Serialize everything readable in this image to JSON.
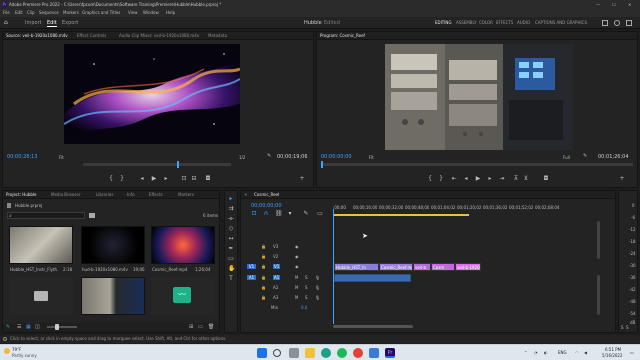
{
  "window": {
    "title": "Adobe Premiere Pro 2022 - C:\\Users\\fpcom\\Documents\\Software Training\\Premiere\\Hubble\\Hubble.prproj *",
    "controls": [
      "—",
      "☐",
      "✕"
    ]
  },
  "menu": [
    "File",
    "Edit",
    "Clip",
    "Sequence",
    "Markers",
    "Graphics and Titles",
    "View",
    "Window",
    "Help"
  ],
  "header": {
    "nav": [
      "Import",
      "Edit",
      "Export"
    ],
    "active_nav": "Edit",
    "project": "Hubble",
    "status": "Edited",
    "workspaces": [
      "EDITING",
      "ASSEMBLY",
      "COLOR",
      "EFFECTS",
      "AUDIO",
      "CAPTIONS AND GRAPHICS"
    ]
  },
  "source": {
    "tabs": [
      "Source: veil-b-1920x1080.m4v",
      "Effect Controls",
      "Audio Clip Mixer: veil-b-1920x1080.m4v",
      "Metadata"
    ],
    "timecode": "00;00;28;13",
    "fit": "Fit",
    "ratio": "1/2",
    "duration": "00;00;19;06"
  },
  "program": {
    "tab": "Program: Cosmic_Reef",
    "timecode": "00;00;00;00",
    "fit": "Fit",
    "quality": "Full",
    "duration": "00;01;26;04"
  },
  "project": {
    "tabs": [
      "Project: Hubble",
      "Media Browser",
      "Libraries",
      "Info",
      "Effects",
      "Markers"
    ],
    "file": "Hubble.prproj",
    "items_count": "6 items",
    "items": [
      {
        "name": "Hubble_HST_Instr_Flyth...",
        "duration": "2:18"
      },
      {
        "name": "hud-b-1920x1080.m4v",
        "duration": "19;06"
      },
      {
        "name": "Cosmic_Reef.mp4",
        "duration": "1;26;04"
      },
      {
        "name": "",
        "duration": ""
      },
      {
        "name": "",
        "duration": ""
      },
      {
        "name": "",
        "duration": ""
      }
    ]
  },
  "timeline": {
    "tab": "Cosmic_Reef",
    "timecode": "00;00;00;00",
    "ruler": [
      ":00;00",
      "00;00;16;00",
      "00;00;32;00",
      "00;00;48;00",
      "00;01;04;02",
      "00;01;20;02",
      "00;01;36;02",
      "00;01;52;02",
      "00;02;08;04"
    ],
    "tracks": [
      "V3",
      "V2",
      "V1",
      "A1",
      "A2",
      "A3",
      "Mix"
    ],
    "mix_value": "0.0",
    "clips": [
      "Hubble_HST_In",
      "Cosmic_Reef.mp",
      "veil-b",
      "Cosm",
      "veil-b-1920x"
    ]
  },
  "audio_meter": {
    "scale": [
      "0",
      "-6",
      "-12",
      "-18",
      "-24",
      "-30",
      "-36",
      "-42",
      "-48",
      "-54",
      "dB"
    ],
    "channels": [
      "S",
      "S"
    ]
  },
  "status_bar": "Click to select, or click in empty space and drag to marquee select. Use Shift, Alt, and Ctrl for other options.",
  "taskbar": {
    "weather_temp": "79°F",
    "weather_desc": "Partly sunny",
    "lang": "ENG",
    "time": "6:51 PM",
    "date": "5/16/2022",
    "colors": {
      "start": "#1a73e8",
      "premiere": "#2a0a5e"
    }
  }
}
